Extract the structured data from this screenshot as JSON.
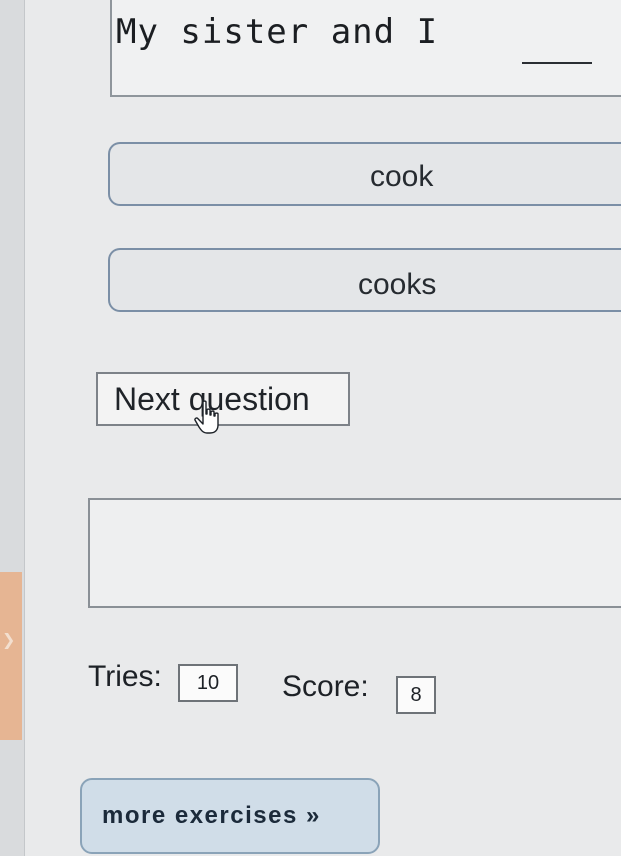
{
  "question": {
    "prompt": "My sister and I",
    "blank": "__"
  },
  "answers": [
    {
      "label": "cook"
    },
    {
      "label": "cooks"
    }
  ],
  "next_button": {
    "label": "Next question"
  },
  "feedback": {
    "text": ""
  },
  "stats": {
    "tries_label": "Tries:",
    "tries_value": "10",
    "score_label": "Score:",
    "score_value": "8"
  },
  "more_button": {
    "label": "more exercises »"
  },
  "icons": {
    "cursor": "hand-pointer-icon",
    "side_tab": "chevron-right-icon"
  },
  "colors": {
    "answer_border": "#7b8fa6",
    "more_button_bg": "#d0dde8",
    "side_tab": "#e6b593"
  }
}
